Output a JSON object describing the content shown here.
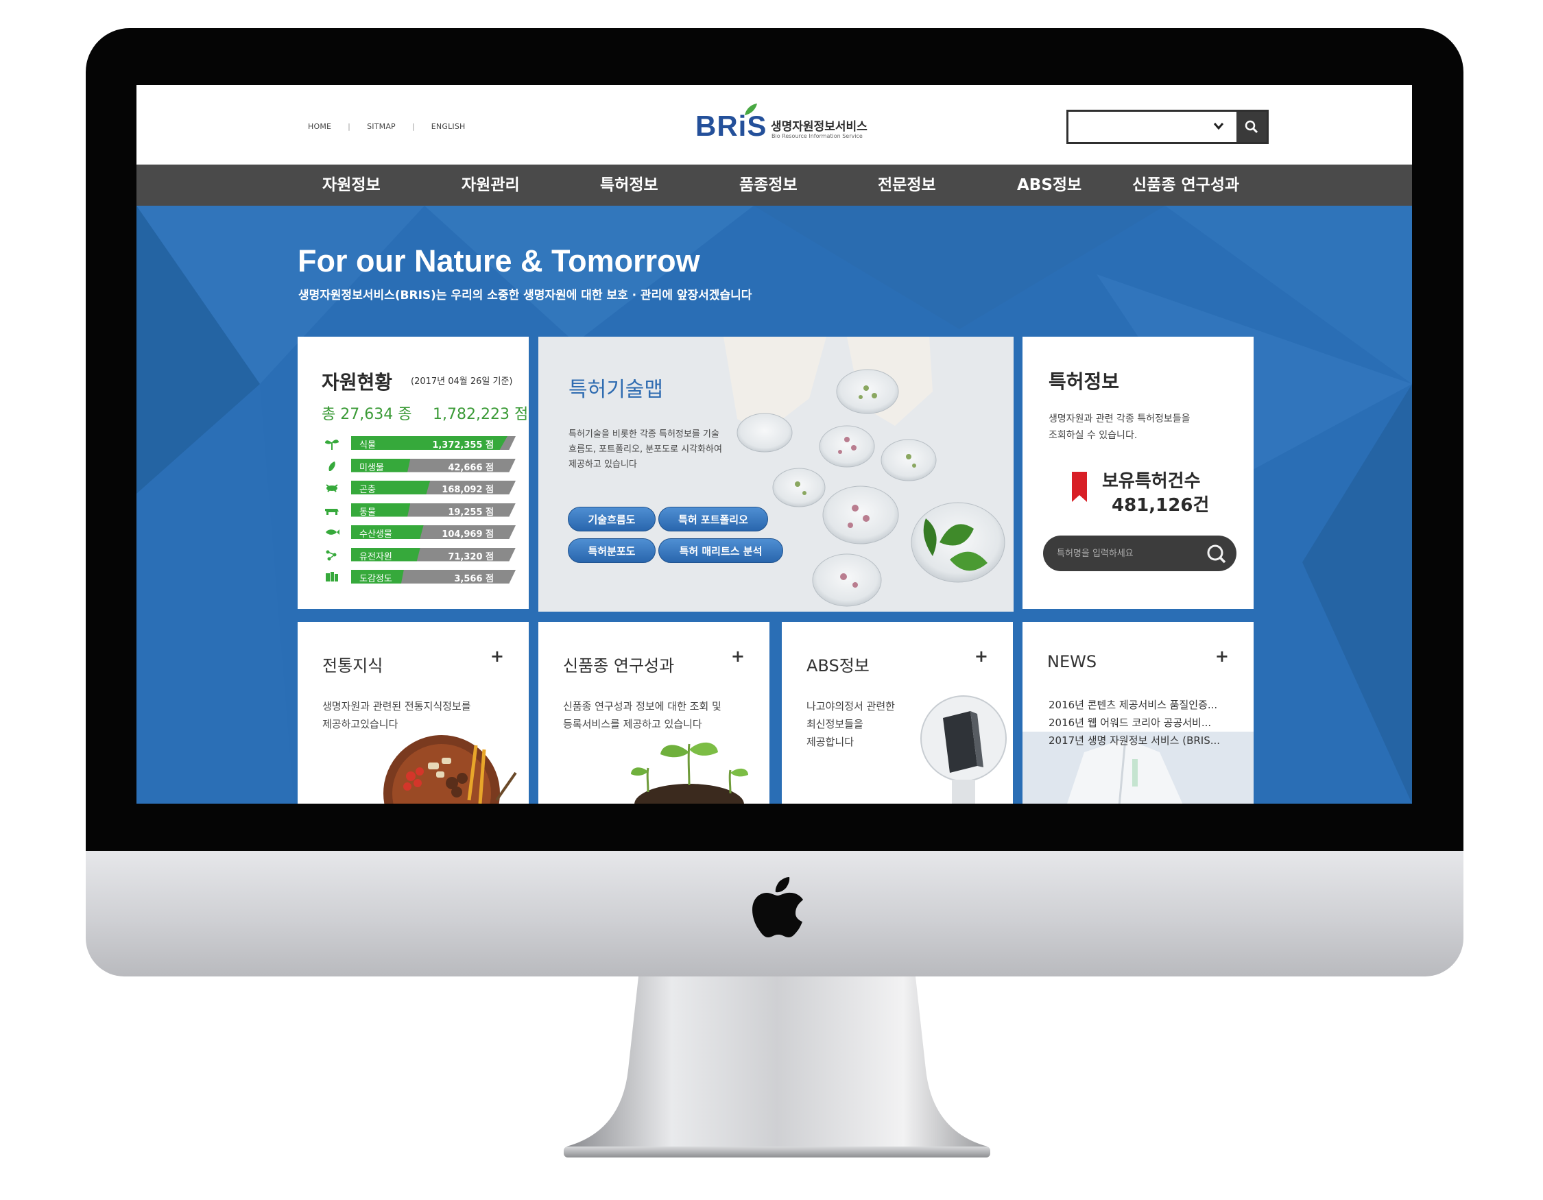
{
  "topbar": {
    "util_links": [
      "HOME",
      "SITMAP",
      "ENGLISH"
    ],
    "separator": "|",
    "logo": {
      "mark": "BRiS",
      "name_kr": "생명자원정보서비스",
      "name_en": "Bio Resource Information Service"
    },
    "search": {
      "select_value": ""
    }
  },
  "gnb": [
    "자원정보",
    "자원관리",
    "특허정보",
    "품종정보",
    "전문정보",
    "ABS정보",
    "신품종 연구성과"
  ],
  "hero": {
    "title": "For our Nature & Tomorrow",
    "subtitle": "생명자원정보서비스(BRIS)는 우리의 소중한 생명자원에 대한 보호 · 관리에 앞장서겠습니다"
  },
  "resources": {
    "title": "자원현황",
    "date": "(2017년 04월 26일 기준)",
    "total_species": "총 27,634 종",
    "total_points": "1,782,223 점",
    "items": [
      {
        "label": "식물",
        "value": "1,372,355 점",
        "fill": 0.95,
        "icon": "plant-icon"
      },
      {
        "label": "미생물",
        "value": "42,666 점",
        "fill": 0.36,
        "icon": "microbe-icon"
      },
      {
        "label": "곤충",
        "value": "168,092 점",
        "fill": 0.48,
        "icon": "insect-icon"
      },
      {
        "label": "동물",
        "value": "19,255 점",
        "fill": 0.36,
        "icon": "animal-icon"
      },
      {
        "label": "수산생물",
        "value": "104,969 점",
        "fill": 0.44,
        "icon": "fish-icon"
      },
      {
        "label": "유전자원",
        "value": "71,320 점",
        "fill": 0.42,
        "icon": "gene-icon"
      },
      {
        "label": "도감정도",
        "value": "3,566 점",
        "fill": 0.32,
        "icon": "book-icon"
      }
    ]
  },
  "patent_map": {
    "title": "특허기술맵",
    "desc": "특허기술을 비롯한 각종 특허정보를 기술흐름도, 포트폴리오, 분포도로 시각화하여 제공하고 있습니다",
    "buttons": [
      "기술흐름도",
      "특허 포트폴리오",
      "특허분포도",
      "특허 매리트스 분석"
    ]
  },
  "patent_info": {
    "title": "특허정보",
    "desc_line1": "생명자원과 관련 각종 특허정보들을",
    "desc_line2": "조회하실 수 있습니다.",
    "count_label": "보유특허건수",
    "count": "481,126건",
    "search_placeholder": "특허명을 입력하세요"
  },
  "traditional": {
    "title": "전통지식",
    "plus": "+",
    "desc_line1": "생명자원과 관련된 전통지식정보를",
    "desc_line2": "제공하고있습니다"
  },
  "new_variety": {
    "title": "신품종 연구성과",
    "plus": "+",
    "desc_line1": "신품종 연구성과 정보에 대한 조회 및",
    "desc_line2": "등록서비스를 제공하고 있습니다"
  },
  "abs": {
    "title": "ABS정보",
    "plus": "+",
    "desc_line1": "나고야의정서 관련한",
    "desc_line2": "최신정보들을",
    "desc_line3": "제공합니다"
  },
  "news": {
    "title": "NEWS",
    "plus": "+",
    "items": [
      "2016년 콘텐츠 제공서비스 품질인증...",
      "2016년 웹 어워드 코리아 공공서비...",
      "2017년 생명 자원정보 서비스 (BRIS..."
    ]
  },
  "colors": {
    "brand_blue": "#24509a",
    "accent_green": "#36a93b",
    "nav_bg": "#4a4a4a",
    "main_bg": "#2a6eb5"
  }
}
